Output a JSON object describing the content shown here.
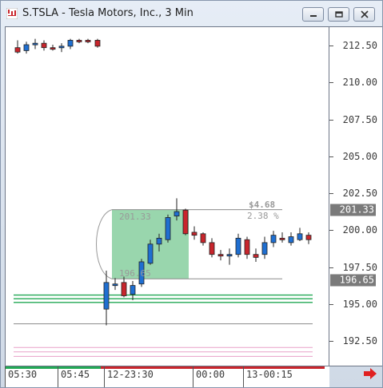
{
  "window": {
    "title": "S.TSLA - Tesla Motors, Inc., 3 Min"
  },
  "price_axis": {
    "ticks": [
      "212.50",
      "210.00",
      "207.50",
      "205.00",
      "202.50",
      "200.00",
      "197.50",
      "195.00",
      "192.50"
    ],
    "current_price_badge": "201.33",
    "measure_low_badge": "196.65"
  },
  "time_axis": {
    "labels": [
      "05:30",
      "05:45",
      "12-23:30",
      "00:00",
      "13-00:15"
    ]
  },
  "measure_tool": {
    "high_label": "201.33",
    "low_label": "196.65",
    "change_label": "$4.68",
    "percent_label": "2.38 %"
  },
  "colors": {
    "up_candle": "#1f6fd1",
    "down_candle": "#c8252c",
    "measure_fill": "#7fcc98",
    "support_green": "#22a855",
    "level_pink": "#e8a0c8",
    "level_gray": "#8a8a8a"
  },
  "chart_data": {
    "type": "candlestick",
    "title": "S.TSLA - Tesla Motors, Inc., 3 Min",
    "ylim": [
      191.0,
      214.0
    ],
    "candles": [
      {
        "o": 212.3,
        "h": 212.8,
        "l": 211.9,
        "c": 212.0
      },
      {
        "o": 212.1,
        "h": 212.7,
        "l": 211.9,
        "c": 212.5
      },
      {
        "o": 212.5,
        "h": 212.9,
        "l": 212.2,
        "c": 212.6
      },
      {
        "o": 212.6,
        "h": 212.8,
        "l": 212.1,
        "c": 212.3
      },
      {
        "o": 212.3,
        "h": 212.5,
        "l": 212.1,
        "c": 212.2
      },
      {
        "o": 212.3,
        "h": 212.6,
        "l": 212.0,
        "c": 212.4
      },
      {
        "o": 212.4,
        "h": 212.9,
        "l": 212.2,
        "c": 212.8
      },
      {
        "o": 212.8,
        "h": 212.9,
        "l": 212.6,
        "c": 212.7
      },
      {
        "o": 212.8,
        "h": 212.9,
        "l": 212.6,
        "c": 212.7
      },
      {
        "o": 212.8,
        "h": 212.9,
        "l": 212.3,
        "c": 212.4
      },
      {
        "o": 194.6,
        "h": 197.2,
        "l": 193.5,
        "c": 196.4
      },
      {
        "o": 196.3,
        "h": 196.7,
        "l": 195.9,
        "c": 196.3
      },
      {
        "o": 196.4,
        "h": 196.8,
        "l": 195.4,
        "c": 195.5
      },
      {
        "o": 195.6,
        "h": 196.5,
        "l": 195.2,
        "c": 196.2
      },
      {
        "o": 196.3,
        "h": 198.0,
        "l": 196.1,
        "c": 197.8
      },
      {
        "o": 197.7,
        "h": 199.3,
        "l": 197.6,
        "c": 199.0
      },
      {
        "o": 199.0,
        "h": 199.7,
        "l": 198.5,
        "c": 199.4
      },
      {
        "o": 199.3,
        "h": 201.0,
        "l": 199.1,
        "c": 200.8
      },
      {
        "o": 200.9,
        "h": 202.1,
        "l": 200.6,
        "c": 201.2
      },
      {
        "o": 201.3,
        "h": 201.4,
        "l": 199.6,
        "c": 199.7
      },
      {
        "o": 199.8,
        "h": 200.2,
        "l": 199.3,
        "c": 199.6
      },
      {
        "o": 199.7,
        "h": 199.8,
        "l": 198.9,
        "c": 199.1
      },
      {
        "o": 199.1,
        "h": 199.4,
        "l": 198.1,
        "c": 198.3
      },
      {
        "o": 198.3,
        "h": 198.6,
        "l": 197.9,
        "c": 198.2
      },
      {
        "o": 198.2,
        "h": 198.7,
        "l": 197.6,
        "c": 198.3
      },
      {
        "o": 198.3,
        "h": 199.7,
        "l": 198.1,
        "c": 199.4
      },
      {
        "o": 199.3,
        "h": 199.5,
        "l": 198.0,
        "c": 198.3
      },
      {
        "o": 198.3,
        "h": 198.7,
        "l": 197.8,
        "c": 198.1
      },
      {
        "o": 198.3,
        "h": 199.5,
        "l": 198.0,
        "c": 199.1
      },
      {
        "o": 199.1,
        "h": 199.9,
        "l": 198.8,
        "c": 199.6
      },
      {
        "o": 199.4,
        "h": 199.8,
        "l": 199.1,
        "c": 199.3
      },
      {
        "o": 199.1,
        "h": 199.8,
        "l": 198.9,
        "c": 199.5
      },
      {
        "o": 199.3,
        "h": 200.1,
        "l": 199.2,
        "c": 199.7
      },
      {
        "o": 199.6,
        "h": 199.8,
        "l": 199.0,
        "c": 199.3
      }
    ],
    "horizontal_levels": [
      {
        "price": 195.55,
        "kind": "green"
      },
      {
        "price": 195.3,
        "kind": "green"
      },
      {
        "price": 195.05,
        "kind": "green"
      },
      {
        "price": 193.6,
        "kind": "gray"
      },
      {
        "price": 192.0,
        "kind": "pink"
      },
      {
        "price": 191.7,
        "kind": "pink"
      },
      {
        "price": 191.4,
        "kind": "pink"
      }
    ]
  }
}
